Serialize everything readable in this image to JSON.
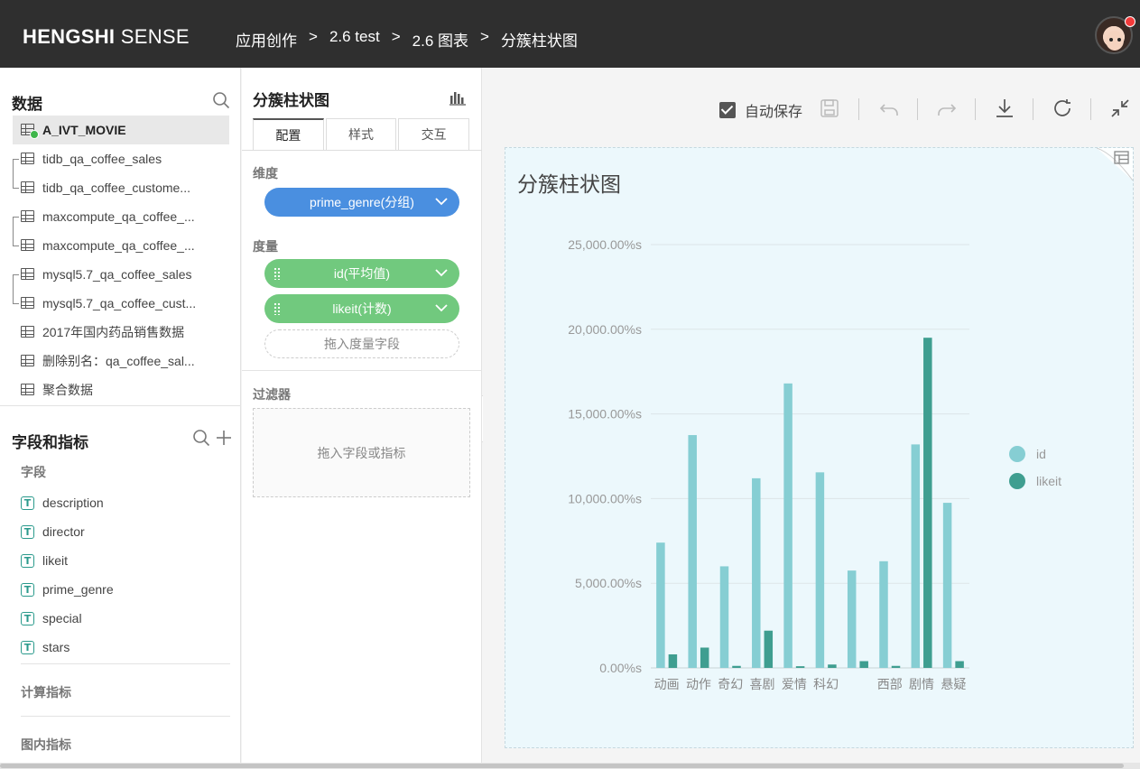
{
  "header": {
    "brand_bold": "HENGSHI",
    "brand_light": "SENSE",
    "breadcrumbs": [
      "应用创作",
      "2.6 test",
      "2.6 图表",
      "分簇柱状图"
    ],
    "separator": ">"
  },
  "data_panel": {
    "title": "数据",
    "datasets": [
      {
        "label": "A_IVT_MOVIE"
      },
      {
        "label": "tidb_qa_coffee_sales"
      },
      {
        "label": "tidb_qa_coffee_custome..."
      },
      {
        "label": "maxcompute_qa_coffee_..."
      },
      {
        "label": "maxcompute_qa_coffee_..."
      },
      {
        "label": "mysql5.7_qa_coffee_sales"
      },
      {
        "label": "mysql5.7_qa_coffee_cust..."
      },
      {
        "label": "2017年国内药品销售数据"
      },
      {
        "label": "删除别名：qa_coffee_sal..."
      },
      {
        "label": "聚合数据"
      }
    ]
  },
  "fields_panel": {
    "title": "字段和指标",
    "fields_label": "字段",
    "fields": [
      "description",
      "director",
      "likeit",
      "prime_genre",
      "special",
      "stars"
    ],
    "field_type_glyph": "T",
    "calc_metrics_label": "计算指标",
    "chart_metrics_label": "图内指标"
  },
  "config_panel": {
    "title": "分簇柱状图",
    "tabs": [
      "配置",
      "样式",
      "交互"
    ],
    "dimension_label": "维度",
    "dimension_pill": "prime_genre(分组)",
    "measure_label": "度量",
    "measure_pills": [
      "id(平均值)",
      "likeit(计数)"
    ],
    "measure_drop": "拖入度量字段",
    "filter_label": "过滤器",
    "filter_drop": "拖入字段或指标"
  },
  "toolbar": {
    "autosave_label": "自动保存"
  },
  "colors": {
    "header_bg": "#2f2f2f",
    "dimension_pill": "#4a8fe0",
    "measure_pill": "#71c97e",
    "series_id": "#86ced3",
    "series_likeit": "#3f9e90"
  },
  "chart_data": {
    "type": "bar",
    "title": "分簇柱状图",
    "categories": [
      "动画",
      "动作",
      "奇幻",
      "喜剧",
      "爱情",
      "科幻",
      "",
      "西部",
      "剧情",
      "悬疑"
    ],
    "series": [
      {
        "name": "id",
        "values": [
          7400,
          13750,
          6000,
          11200,
          16800,
          11550,
          5750,
          6300,
          13200,
          9750
        ]
      },
      {
        "name": "likeit",
        "values": [
          800,
          1200,
          120,
          2200,
          100,
          200,
          400,
          120,
          19500,
          400
        ]
      }
    ],
    "y_ticks": [
      "0.00%s",
      "5,000.00%s",
      "10,000.00%s",
      "15,000.00%s",
      "20,000.00%s",
      "25,000.00%s"
    ],
    "ylim": [
      0,
      25000
    ],
    "grid": true,
    "legend": "right"
  }
}
